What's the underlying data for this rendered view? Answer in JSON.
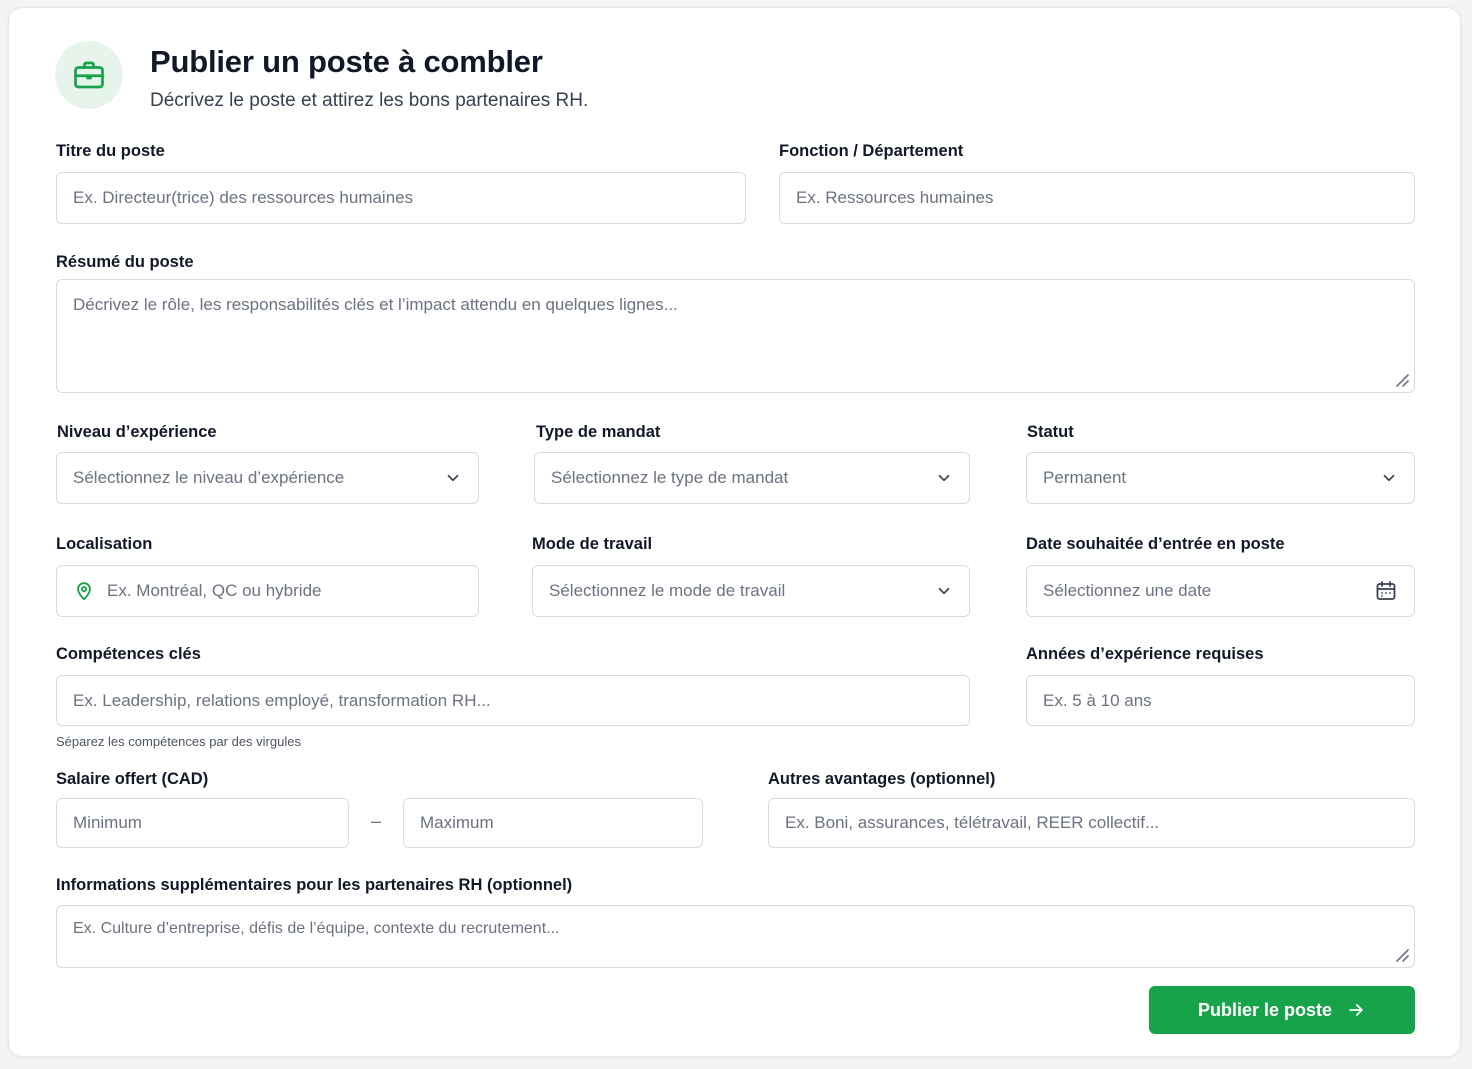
{
  "header": {
    "icon": "briefcase-icon",
    "title": "Publier un poste à combler",
    "subtitle": "Décrivez le poste et attirez les bons partenaires RH."
  },
  "fields": {
    "job_title": {
      "label": "Titre du poste",
      "placeholder": "Ex. Directeur(trice) des ressources humaines"
    },
    "department": {
      "label": "Fonction / Département",
      "placeholder": "Ex. Ressources humaines"
    },
    "summary": {
      "label": "Résumé du poste",
      "placeholder": "Décrivez le rôle, les responsabilités clés et l’impact attendu en quelques lignes..."
    },
    "experience_level": {
      "label": "Niveau d’expérience",
      "value": "Sélectionnez le niveau d’expérience"
    },
    "mandate_type": {
      "label": "Type de mandat",
      "value": "Sélectionnez le type de mandat"
    },
    "status": {
      "label": "Statut",
      "value": "Permanent"
    },
    "location": {
      "label": "Localisation",
      "placeholder": "Ex. Montréal, QC ou hybride"
    },
    "work_mode": {
      "label": "Mode de travail",
      "value": "Sélectionnez le mode de travail"
    },
    "start_date": {
      "label": "Date souhaitée d’entrée en poste",
      "value": "Sélectionnez une date"
    },
    "skills": {
      "label": "Compétences clés",
      "placeholder": "Ex. Leadership, relations employé, transformation RH...",
      "hint": "Séparez les compétences par des virgules"
    },
    "years_required": {
      "label": "Années d’expérience requises",
      "placeholder": "Ex. 5 à 10 ans"
    },
    "salary": {
      "label": "Salaire offert (CAD)",
      "min_placeholder": "Minimum",
      "separator": "–",
      "max_placeholder": "Maximum"
    },
    "benefits": {
      "label": "Autres avantages (optionnel)",
      "placeholder": "Ex. Boni, assurances, télétravail, REER collectif..."
    },
    "extra_info": {
      "label": "Informations supplémentaires pour les partenaires RH (optionnel)",
      "placeholder": "Ex. Culture d’entreprise, défis de l’équipe, contexte du recrutement..."
    }
  },
  "actions": {
    "submit_label": "Publier le poste",
    "submit_icon": "arrow-right-icon"
  },
  "colors": {
    "accent": "#16a34a",
    "accent_soft": "#e6f4ec",
    "border": "#d6dbe0"
  }
}
